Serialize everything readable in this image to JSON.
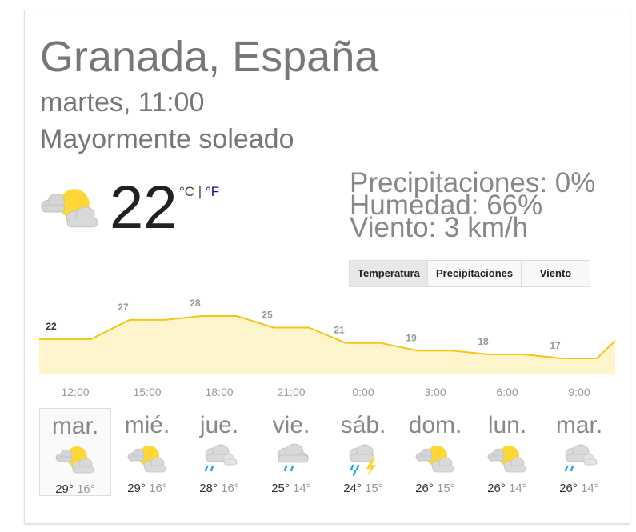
{
  "location": "Granada, España",
  "datetime": "martes, 11:00",
  "condition": "Mayormente soleado",
  "current": {
    "temp": "22",
    "unit_c": "°C",
    "unit_sep": " | ",
    "unit_f": "°F",
    "icon": "partly-cloudy-icon"
  },
  "details": {
    "precip": "Precipitaciones: 0%",
    "humidity": "Humedad: 66%",
    "wind": "Viento: 3 km/h"
  },
  "tabs": [
    {
      "label": "Temperatura",
      "active": true
    },
    {
      "label": "Precipitaciones",
      "active": false
    },
    {
      "label": "Viento",
      "active": false
    }
  ],
  "chart_data": {
    "type": "area",
    "x": [
      "12:00",
      "15:00",
      "18:00",
      "21:00",
      "0:00",
      "3:00",
      "6:00",
      "9:00"
    ],
    "values": [
      22,
      27,
      28,
      25,
      21,
      19,
      18,
      17
    ],
    "data_labels": [
      "22",
      "27",
      "28",
      "25",
      "21",
      "19",
      "18",
      "17"
    ],
    "fill_color": "#fff5cc",
    "line_color": "#f5c518"
  },
  "days": [
    {
      "name": "mar.",
      "hi": "29°",
      "lo": "16°",
      "icon": "partly-cloudy-icon",
      "selected": true
    },
    {
      "name": "mié.",
      "hi": "29°",
      "lo": "16°",
      "icon": "partly-cloudy-icon",
      "selected": false
    },
    {
      "name": "jue.",
      "hi": "28°",
      "lo": "16°",
      "icon": "rain-showers-icon",
      "selected": false
    },
    {
      "name": "vie.",
      "hi": "25°",
      "lo": "14°",
      "icon": "rain-icon",
      "selected": false
    },
    {
      "name": "sáb.",
      "hi": "24°",
      "lo": "15°",
      "icon": "thunderstorm-icon",
      "selected": false
    },
    {
      "name": "dom.",
      "hi": "26°",
      "lo": "15°",
      "icon": "partly-cloudy-icon",
      "selected": false
    },
    {
      "name": "lun.",
      "hi": "26°",
      "lo": "14°",
      "icon": "partly-cloudy-icon",
      "selected": false
    },
    {
      "name": "mar.",
      "hi": "26°",
      "lo": "14°",
      "icon": "rain-showers-icon",
      "selected": false
    }
  ]
}
